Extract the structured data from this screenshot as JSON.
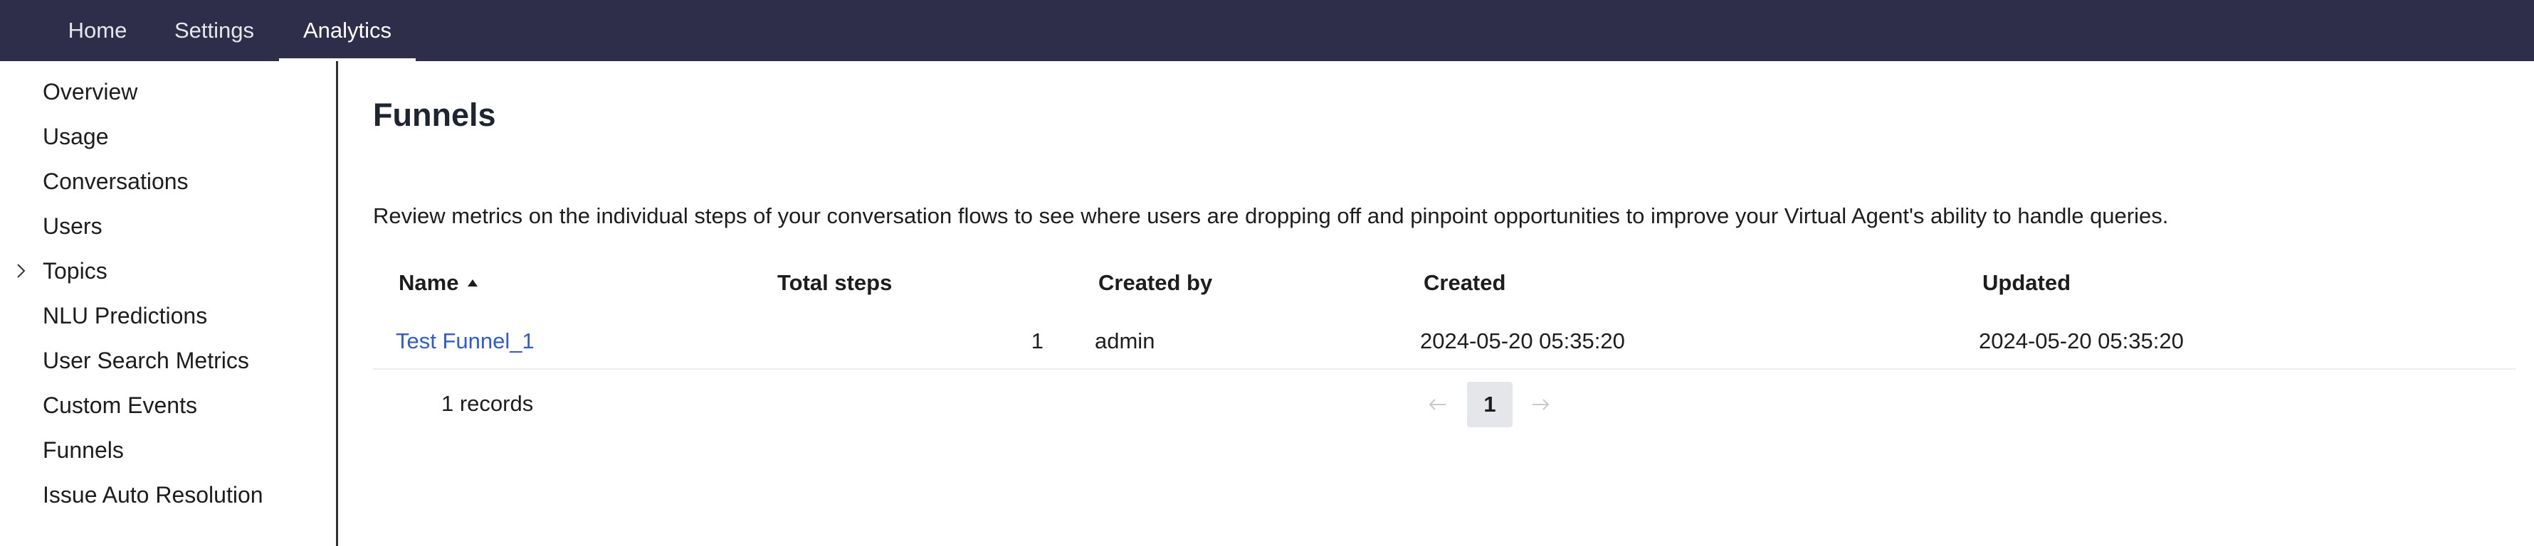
{
  "topnav": {
    "tabs": [
      {
        "label": "Home",
        "active": false
      },
      {
        "label": "Settings",
        "active": false
      },
      {
        "label": "Analytics",
        "active": true
      }
    ]
  },
  "sidebar": {
    "items": [
      {
        "label": "Overview"
      },
      {
        "label": "Usage"
      },
      {
        "label": "Conversations"
      },
      {
        "label": "Users"
      },
      {
        "label": "Topics",
        "expandable": true
      },
      {
        "label": "NLU Predictions"
      },
      {
        "label": "User Search Metrics"
      },
      {
        "label": "Custom Events"
      },
      {
        "label": "Funnels"
      },
      {
        "label": "Issue Auto Resolution"
      }
    ]
  },
  "main": {
    "title": "Funnels",
    "description": "Review metrics on the individual steps of your conversation flows to see where users are dropping off and pinpoint opportunities to improve your Virtual Agent's ability to handle queries.",
    "table": {
      "columns": [
        "Name",
        "Total steps",
        "Created by",
        "Created",
        "Updated"
      ],
      "sort": {
        "column": "Name",
        "direction": "ascending"
      },
      "rows": [
        {
          "name": "Test Funnel_1",
          "total_steps": "1",
          "created_by": "admin",
          "created": "2024-05-20 05:35:20",
          "updated": "2024-05-20 05:35:20"
        }
      ]
    },
    "footer": {
      "records": "1 records",
      "current_page": "1",
      "prev_icon": "arrow-left-icon",
      "next_icon": "arrow-right-icon"
    }
  },
  "colors": {
    "topnav_bg": "#2e2e4a",
    "link": "#2f5bd6",
    "page_highlight": "#e5e6ea"
  }
}
